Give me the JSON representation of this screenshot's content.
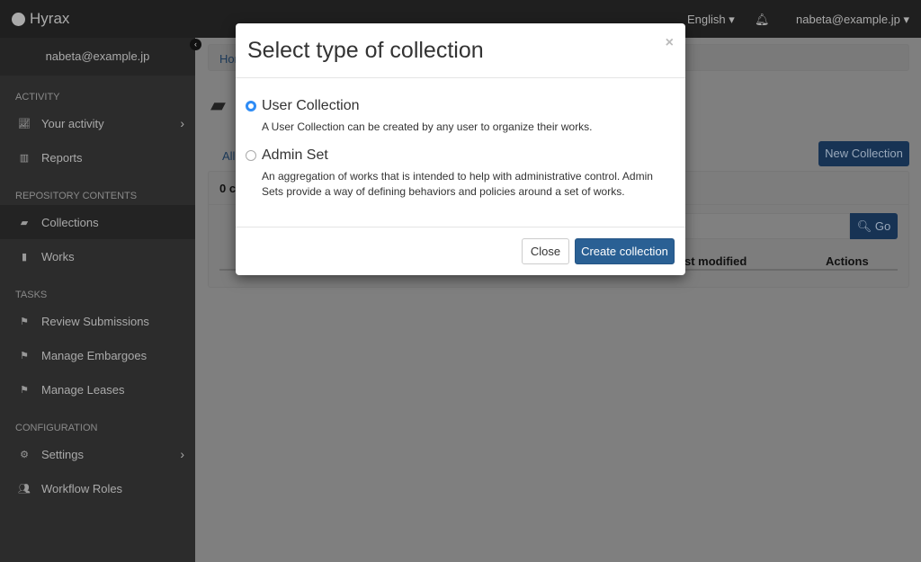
{
  "navbar": {
    "brand": "Hyrax",
    "language": "English ▾",
    "user": "nabeta@example.jp"
  },
  "sidebar": {
    "user": "nabeta@example.jp",
    "sections": [
      {
        "title": "ACTIVITY",
        "items": [
          {
            "label": "Your activity",
            "icon": "line-chart-icon"
          },
          {
            "label": "Reports",
            "icon": "bar-chart-icon"
          }
        ]
      },
      {
        "title": "REPOSITORY CONTENTS",
        "items": [
          {
            "label": "Collections",
            "icon": "folder-open-icon"
          },
          {
            "label": "Works",
            "icon": "file-icon"
          }
        ]
      },
      {
        "title": "TASKS",
        "items": [
          {
            "label": "Review Submissions",
            "icon": "flag-icon"
          },
          {
            "label": "Manage Embargoes",
            "icon": "flag-icon"
          },
          {
            "label": "Manage Leases",
            "icon": "flag-icon"
          }
        ]
      },
      {
        "title": "CONFIGURATION",
        "items": [
          {
            "label": "Settings",
            "icon": "gear-icon"
          },
          {
            "label": "Workflow Roles",
            "icon": "users-icon"
          }
        ]
      }
    ]
  },
  "main": {
    "breadcrumb": "Hor",
    "tab_all": "All",
    "count": "0 c",
    "new_collection": "New Collection",
    "go": "Go",
    "col_last_modified": "st modified",
    "col_actions": "Actions"
  },
  "modal": {
    "title": "Select type of collection",
    "close_x": "×",
    "options": [
      {
        "label": "User Collection",
        "selected": true,
        "description": "A User Collection can be created by any user to organize their works."
      },
      {
        "label": "Admin Set",
        "selected": false,
        "description": "An aggregation of works that is intended to help with administrative control. Admin Sets provide a way of defining behaviors and policies around a set of works."
      }
    ],
    "close_button": "Close",
    "create_button": "Create collection",
    "accent": "#2a6094"
  }
}
